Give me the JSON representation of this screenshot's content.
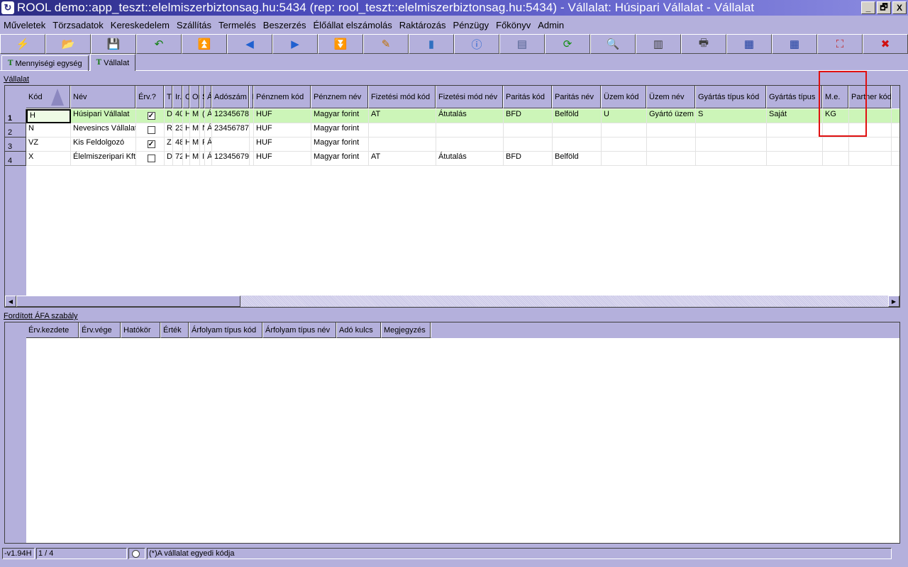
{
  "window": {
    "title": "ROOL demo::app_teszt::elelmiszerbiztonsag.hu:5434 (rep: rool_teszt::elelmiszerbiztonsag.hu:5434) - Vállalat: Húsipari Vállalat - Vállalat",
    "buttons": [
      "_",
      "🗗",
      "X"
    ]
  },
  "menu": [
    "Műveletek",
    "Törzsadatok",
    "Kereskedelem",
    "Szállítás",
    "Termelés",
    "Beszerzés",
    "Élőállat elszámolás",
    "Raktározás",
    "Pénzügy",
    "Főkönyv",
    "Admin"
  ],
  "toolbar": [
    {
      "icon": "lightning-icon",
      "glyph": "⚡",
      "color": "#d08000"
    },
    {
      "icon": "open-folder-icon",
      "glyph": "📂",
      "color": "#2050c0"
    },
    {
      "icon": "save-icon",
      "glyph": "💾",
      "color": "#303060"
    },
    {
      "icon": "undo-icon",
      "glyph": "↶",
      "color": "#108010"
    },
    {
      "icon": "first-record-icon",
      "glyph": "⏫",
      "color": "#2060d0"
    },
    {
      "icon": "previous-record-icon",
      "glyph": "◀",
      "color": "#2060d0"
    },
    {
      "icon": "next-record-icon",
      "glyph": "▶",
      "color": "#2060d0"
    },
    {
      "icon": "last-record-icon",
      "glyph": "⏬",
      "color": "#2060d0"
    },
    {
      "icon": "edit-icon",
      "glyph": "✎",
      "color": "#c07000"
    },
    {
      "icon": "database-icon",
      "glyph": "▮",
      "color": "#3070c0"
    },
    {
      "icon": "info-icon",
      "glyph": "ⓘ",
      "color": "#2060d0"
    },
    {
      "icon": "form-view-icon",
      "glyph": "▤",
      "color": "#506090"
    },
    {
      "icon": "refresh-icon",
      "glyph": "⟳",
      "color": "#109010"
    },
    {
      "icon": "search-icon",
      "glyph": "🔍",
      "color": "#404040"
    },
    {
      "icon": "columns-icon",
      "glyph": "▥",
      "color": "#404040"
    },
    {
      "icon": "print-icon",
      "glyph": "🖶",
      "color": "#404040"
    },
    {
      "icon": "grid-export-icon",
      "glyph": "▦",
      "color": "#2040a0"
    },
    {
      "icon": "grid-import-icon",
      "glyph": "▦",
      "color": "#2040a0"
    },
    {
      "icon": "fullscreen-icon",
      "glyph": "⛶",
      "color": "#c02020"
    },
    {
      "icon": "close-icon",
      "glyph": "✖",
      "color": "#d01010"
    }
  ],
  "tabs": [
    {
      "label": "Mennyiségi egység",
      "active": false,
      "icon": "T"
    },
    {
      "label": "Vállalat",
      "active": true,
      "icon": "T"
    }
  ],
  "vallalat": {
    "section_label": "Vállalat",
    "columns": [
      "Kód",
      "Név",
      "Érv.?",
      "T",
      "Ir.",
      "C",
      "Or",
      "S",
      "Á",
      "Adószám",
      "I",
      "Pénznem kód",
      "Pénznem név",
      "Fizetési mód kód",
      "Fizetési mód név",
      "Paritás kód",
      "Paritás név",
      "Üzem kód",
      "Üzem név",
      "Gyártás típus kód",
      "Gyártás típus",
      "M.e.",
      "Partner kód"
    ],
    "rows": [
      {
        "num": "1",
        "cells": [
          "H",
          "Húsipari Vállalat",
          true,
          "D",
          "40",
          "H",
          "M",
          "(",
          "Á",
          "12345678",
          "",
          "HUF",
          "Magyar forint",
          "AT",
          "Átutalás",
          "BFD",
          "Belföld",
          "U",
          "Gyártó üzem",
          "S",
          "Saját",
          "KG",
          ""
        ]
      },
      {
        "num": "2",
        "cells": [
          "N",
          "Nevesincs Vállalat",
          false,
          "R",
          "23",
          "H",
          "M",
          "N",
          "Á",
          "23456787",
          "",
          "HUF",
          "Magyar forint",
          "",
          "",
          "",
          "",
          "",
          "",
          "",
          "",
          "",
          ""
        ]
      },
      {
        "num": "3",
        "cells": [
          "VZ",
          "Kis Feldolgozó",
          true,
          "Z",
          "48",
          "H",
          "M",
          "F",
          "Á",
          "",
          "",
          "HUF",
          "Magyar forint",
          "",
          "",
          "",
          "",
          "",
          "",
          "",
          "",
          "",
          ""
        ]
      },
      {
        "num": "4",
        "cells": [
          "X",
          "Élelmiszeripari Kft.",
          false,
          "D",
          "72",
          "H",
          "M",
          "I",
          "Á",
          "12345679",
          "",
          "HUF",
          "Magyar forint",
          "AT",
          "Átutalás",
          "BFD",
          "Belföld",
          "",
          "",
          "",
          "",
          "",
          ""
        ]
      }
    ],
    "selected_row": 0,
    "selected_color": "#ccf5b8"
  },
  "afa": {
    "section_label": "Fordított ÁFA szabály",
    "columns": [
      "Érv.kezdete",
      "Érv.vége",
      "Hatókör",
      "Érték",
      "Árfolyam típus kód",
      "Árfolyam típus név",
      "Adó kulcs",
      "Megjegyzés"
    ]
  },
  "status": {
    "version": "-v1.94H",
    "record": "1 / 4",
    "hint": "(*)A vállalat egyedi kódja"
  },
  "highlight_color": "#e01010"
}
